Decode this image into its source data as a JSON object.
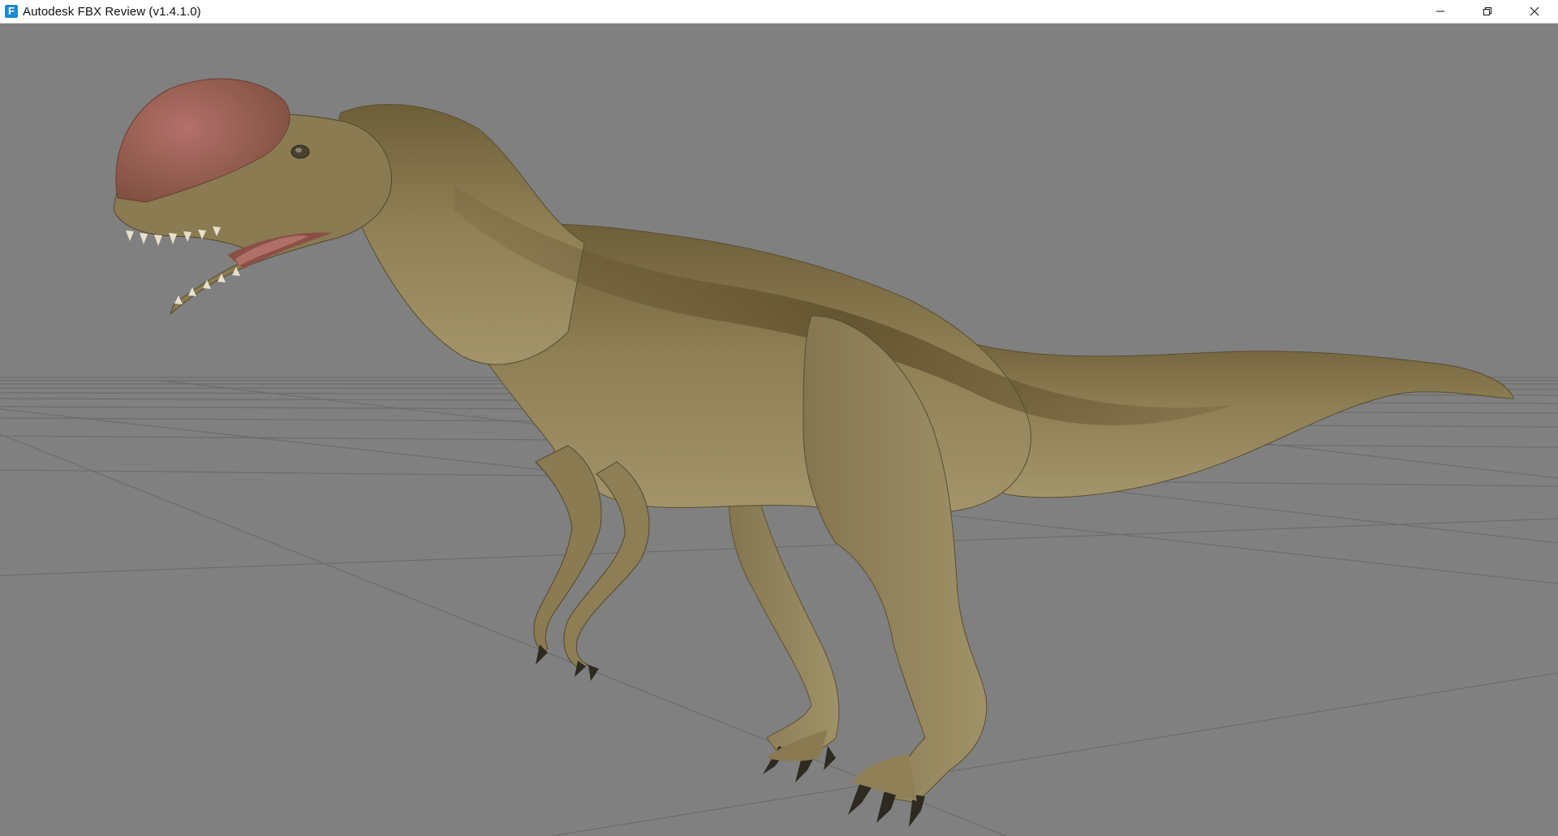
{
  "window": {
    "title": "Autodesk FBX Review (v1.4.1.0)",
    "app_icon_letter": "F",
    "caption_buttons": [
      "minimize-icon",
      "restore-icon",
      "close-icon"
    ]
  },
  "viewport": {
    "background_color": "#808080",
    "grid_color": "#6f6f6f",
    "model": "dinosaur",
    "colors": {
      "body": "#8c7d55",
      "crest": "#a0605a",
      "stripe": "#5e4e2e"
    }
  }
}
